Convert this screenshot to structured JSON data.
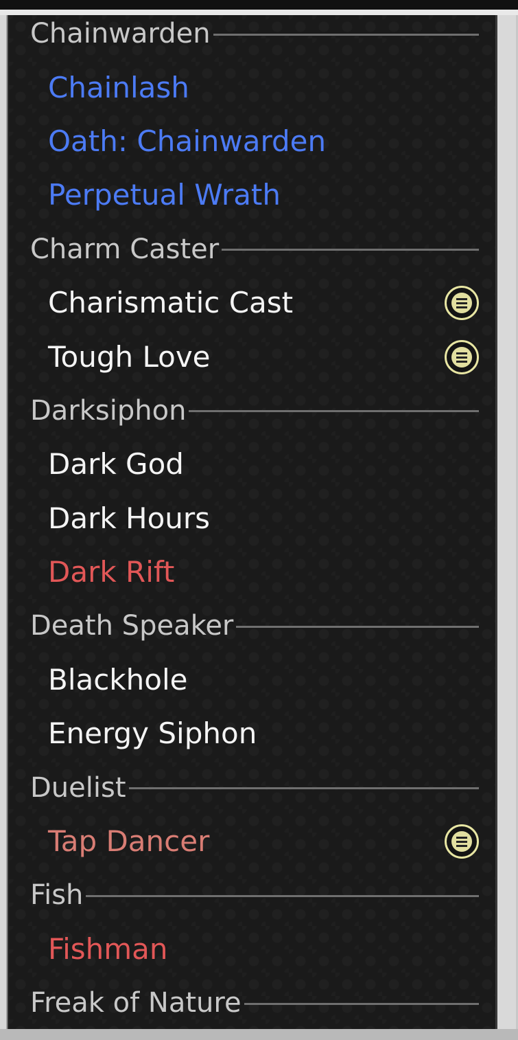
{
  "palette": {
    "header_text": "#c8c8c8",
    "header_rule": "#6f6f6f",
    "blue": "#4c7bf5",
    "white": "#f4f4f4",
    "red": "#e25757",
    "salmon": "#d97d74",
    "badge": "#e2dfa0"
  },
  "groups": [
    {
      "name": "Chainwarden",
      "items": [
        {
          "label": "Chainlash",
          "color": "blue",
          "badge": false
        },
        {
          "label": "Oath: Chainwarden",
          "color": "blue",
          "badge": false
        },
        {
          "label": "Perpetual Wrath",
          "color": "blue",
          "badge": false
        }
      ]
    },
    {
      "name": "Charm Caster",
      "items": [
        {
          "label": "Charismatic Cast",
          "color": "white",
          "badge": true
        },
        {
          "label": "Tough Love",
          "color": "white",
          "badge": true
        }
      ]
    },
    {
      "name": "Darksiphon",
      "items": [
        {
          "label": "Dark God",
          "color": "white",
          "badge": false
        },
        {
          "label": "Dark Hours",
          "color": "white",
          "badge": false
        },
        {
          "label": "Dark Rift",
          "color": "red",
          "badge": false
        }
      ]
    },
    {
      "name": "Death Speaker",
      "items": [
        {
          "label": "Blackhole",
          "color": "white",
          "badge": false
        },
        {
          "label": "Energy Siphon",
          "color": "white",
          "badge": false
        }
      ]
    },
    {
      "name": "Duelist",
      "items": [
        {
          "label": "Tap Dancer",
          "color": "salmon",
          "badge": true
        }
      ]
    },
    {
      "name": "Fish",
      "items": [
        {
          "label": "Fishman",
          "color": "red",
          "badge": false
        }
      ]
    },
    {
      "name": "Freak of Nature",
      "items": []
    }
  ],
  "icons": {
    "badge": "equal-circle-icon"
  }
}
